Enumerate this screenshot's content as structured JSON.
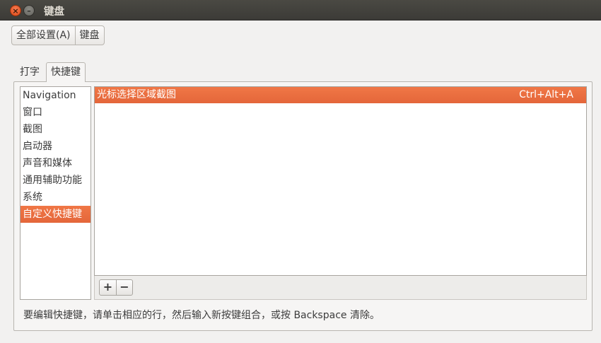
{
  "window": {
    "title": "键盘",
    "close_glyph": "×",
    "minimize_glyph": "–"
  },
  "breadcrumb": {
    "all_settings": "全部设置(A)",
    "current": "键盘"
  },
  "tabs": [
    {
      "label": "打字",
      "active": false
    },
    {
      "label": "快捷键",
      "active": true
    }
  ],
  "categories": [
    {
      "label": "Navigation"
    },
    {
      "label": "窗口"
    },
    {
      "label": "截图"
    },
    {
      "label": "启动器"
    },
    {
      "label": "声音和媒体"
    },
    {
      "label": "通用辅助功能"
    },
    {
      "label": "系统"
    },
    {
      "label": "自定义快捷键",
      "selected": true
    }
  ],
  "shortcuts": [
    {
      "name": "光标选择区域截图",
      "accel": "Ctrl+Alt+A",
      "selected": true
    }
  ],
  "toolbar": {
    "add_label": "+",
    "remove_label": "−"
  },
  "hint": "要编辑快捷键，请单击相应的行，然后输入新按键组合，或按 Backspace 清除。",
  "colors": {
    "accent": "#e96c3e",
    "titlebar": "#3c3b37",
    "background": "#f2f1f0"
  }
}
